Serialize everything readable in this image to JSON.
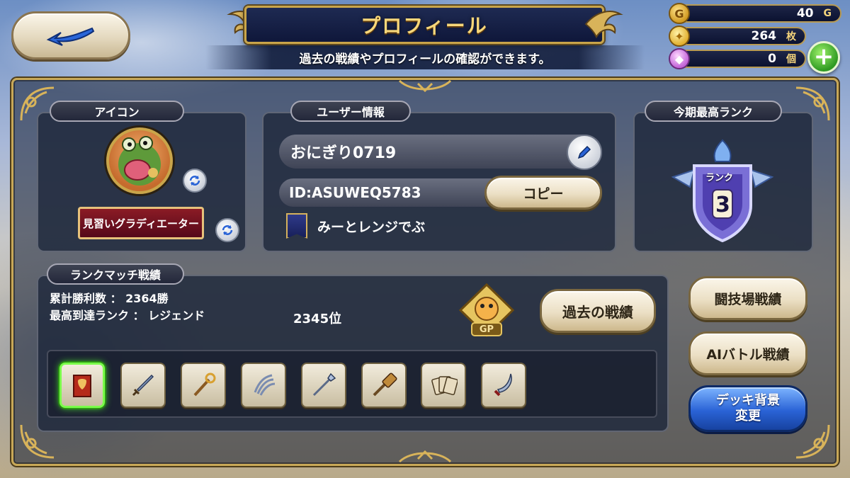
{
  "header": {
    "title": "プロフィール",
    "subtitle": "過去の戦績やプロフィールの確認ができます。"
  },
  "currencies": [
    {
      "icon": "gold-coin-icon",
      "value": "40",
      "unit": "G"
    },
    {
      "icon": "medal-icon",
      "value": "264",
      "unit": "枚"
    },
    {
      "icon": "gem-icon",
      "value": "0",
      "unit": "個"
    }
  ],
  "icon_panel": {
    "label": "アイコン",
    "title": "見習いグラディエーター"
  },
  "user_panel": {
    "label": "ユーザー情報",
    "name": "おにぎり0719",
    "id": "ID:ASUWEQ5783",
    "copy_label": "コピー",
    "guild_name": "みーとレンジでぶ"
  },
  "rank_panel": {
    "label": "今期最高ランク",
    "rank_caption": "ランク",
    "rank_value": "3"
  },
  "rank_match": {
    "label": "ランクマッチ戦績",
    "wins_line": "累計勝利数 ： 2364勝",
    "best_rank_line": "最高到達ランク ： レジェンド",
    "position": "2345位",
    "gp_label": "GP",
    "history_button": "過去の戦績"
  },
  "side_buttons": {
    "arena": "闘技場戦績",
    "ai_battle": "AIバトル戦績",
    "deck_bg_line1": "デッキ背景",
    "deck_bg_line2": "変更"
  },
  "weapons": [
    {
      "name": "banner-weapon-icon",
      "selected": true
    },
    {
      "name": "sword-icon",
      "selected": false
    },
    {
      "name": "staff-icon",
      "selected": false
    },
    {
      "name": "claw-icon",
      "selected": false
    },
    {
      "name": "spear-icon",
      "selected": false
    },
    {
      "name": "hammer-icon",
      "selected": false
    },
    {
      "name": "cards-icon",
      "selected": false
    },
    {
      "name": "scimitar-icon",
      "selected": false
    }
  ],
  "colors": {
    "gold": "#c9a54a",
    "selected_glow": "#7aff4a",
    "blue_button": "#2a63d6"
  }
}
